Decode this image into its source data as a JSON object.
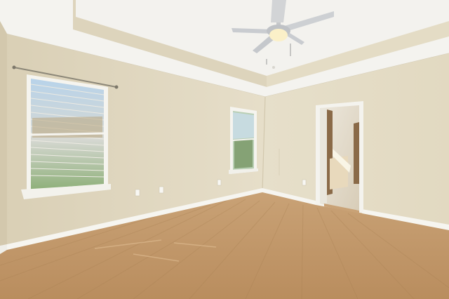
{
  "scene": {
    "type": "empty-room-photo",
    "elements": [
      "tray-ceiling",
      "ceiling-fan-with-light",
      "left-window-with-blinds",
      "center-window",
      "open-doorway-to-bathroom",
      "electrical-outlets",
      "white-baseboards",
      "light-wood-laminate-floor"
    ]
  },
  "colors": {
    "ceiling": "#f1f0ec",
    "tray_face": "#ddd5bc",
    "wall_left": "#e2d9c2",
    "wall_back": "#e6dec8",
    "floor": "#c49a6c",
    "trim": "#f7f6f2",
    "window_glass": "#a9c8e0",
    "fan_blade": "#cfd1d3"
  }
}
